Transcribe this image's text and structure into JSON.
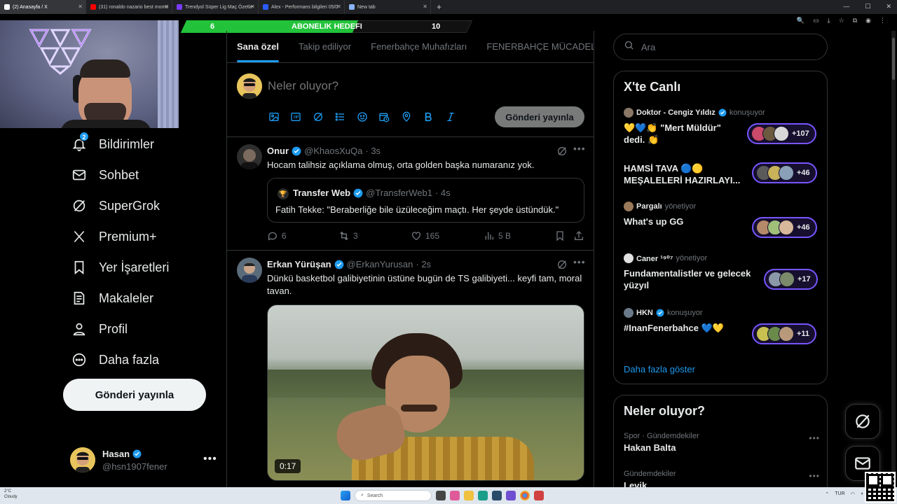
{
  "browser": {
    "tabs": [
      {
        "title": "(2) Anasayfa / X",
        "color": "#ffffff",
        "active": true
      },
      {
        "title": "(31) ronaldo nazario best mome",
        "color": "#ff0000",
        "active": false
      },
      {
        "title": "Trendyol Süper Lig Maç Özetle",
        "color": "#7a3cff",
        "active": false
      },
      {
        "title": "Alex - Performans bilgileri 05/0",
        "color": "#2b5cff",
        "active": false
      },
      {
        "title": "New tab",
        "color": "#8ab4f8",
        "active": false
      }
    ],
    "new_tab": "+",
    "window_controls": [
      "—",
      "☐",
      "✕"
    ]
  },
  "overlay": {
    "sub_goal_current": "6",
    "sub_goal_label": "ABONELIK HEDEFI",
    "sub_goal_target": "10",
    "sub_goal_progress": 0.6,
    "accent": "#22c33a"
  },
  "nav": {
    "notifications_badge": "2",
    "items": [
      {
        "label": "Bildirimler",
        "icon": "bell-icon"
      },
      {
        "label": "Sohbet",
        "icon": "mail-icon"
      },
      {
        "label": "SuperGrok",
        "icon": "grok-icon"
      },
      {
        "label": "Premium+",
        "icon": "x-logo-icon"
      },
      {
        "label": "Yer İşaretleri",
        "icon": "bookmark-icon"
      },
      {
        "label": "Makaleler",
        "icon": "article-icon"
      },
      {
        "label": "Profil",
        "icon": "person-icon"
      },
      {
        "label": "Daha fazla",
        "icon": "more-circle-icon"
      }
    ],
    "post_button": "Gönderi yayınla"
  },
  "account": {
    "name": "Hasan",
    "handle": "@hsn1907fener",
    "more": "•••"
  },
  "timeline": {
    "tabs": [
      "Sana özel",
      "Takip ediliyor",
      "Fenerbahçe Muhafızları",
      "FENERBAHÇE MÜCADELE"
    ],
    "compose_placeholder": "Neler oluyor?",
    "compose_button": "Gönderi yayınla",
    "tweets": [
      {
        "name": "Onur",
        "handle": "@KhaosXuQa",
        "time": "· 3s",
        "text": "Hocam talihsiz açıklama olmuş, orta golden başka numaranız yok.",
        "quote": {
          "name": "Transfer Web",
          "handle": "@TransferWeb1",
          "time": "· 4s",
          "text": "Fatih Tekke: \"Beraberliğe bile üzüleceğim maçtı. Her şeyde üstündük.\""
        },
        "replies": "6",
        "reposts": "3",
        "likes": "165",
        "views": "5 B"
      },
      {
        "name": "Erkan Yürüşan",
        "handle": "@ErkanYurusan",
        "time": "· 2s",
        "text": "Dünkü basketbol galibiyetinin üstüne bugün de TS galibiyeti... keyfi tam, moral tavan.",
        "video_duration": "0:17"
      }
    ]
  },
  "search": {
    "placeholder": "Ara"
  },
  "live": {
    "title": "X'te Canlı",
    "items": [
      {
        "host": "Doktor - Cengiz Yıldız",
        "status": "konuşuyor",
        "title": "💛💙👏 \"Mert Müldür\" dedi. 👏",
        "count": "+107",
        "verified": true
      },
      {
        "host": "",
        "status": "",
        "title": "HAMSİ TAVA 🔵🟡 MEŞALELERİ HAZIRLAYI...",
        "count": "+46",
        "verified": false
      },
      {
        "host": "Pargalı",
        "status": "yönetiyor",
        "title": "What's up GG",
        "count": "+46",
        "verified": false
      },
      {
        "host": "Caner ¹⁹⁰⁷",
        "status": "yönetiyor",
        "title": "Fundamentalistler ve gelecek yüzyıl",
        "count": "+17",
        "verified": false
      },
      {
        "host": "HKN",
        "status": "konuşuyor",
        "title": "#InanFenerbahce 💙💛",
        "count": "+11",
        "verified": true
      }
    ],
    "show_more": "Daha fazla göster",
    "pill_border": "#7856ff"
  },
  "trends": {
    "title": "Neler oluyor?",
    "items": [
      {
        "category": "Spor · Gündemdekiler",
        "name": "Hakan Balta"
      },
      {
        "category": "Gündemdekiler",
        "name": "Levik"
      }
    ]
  },
  "taskbar": {
    "temperature": "2°C",
    "weather": "Cloudy",
    "search_placeholder": "Search",
    "lang": "TUR"
  },
  "colors": {
    "accent": "#1d9bf0",
    "verified": "#1d9bf0",
    "background": "#000000"
  }
}
